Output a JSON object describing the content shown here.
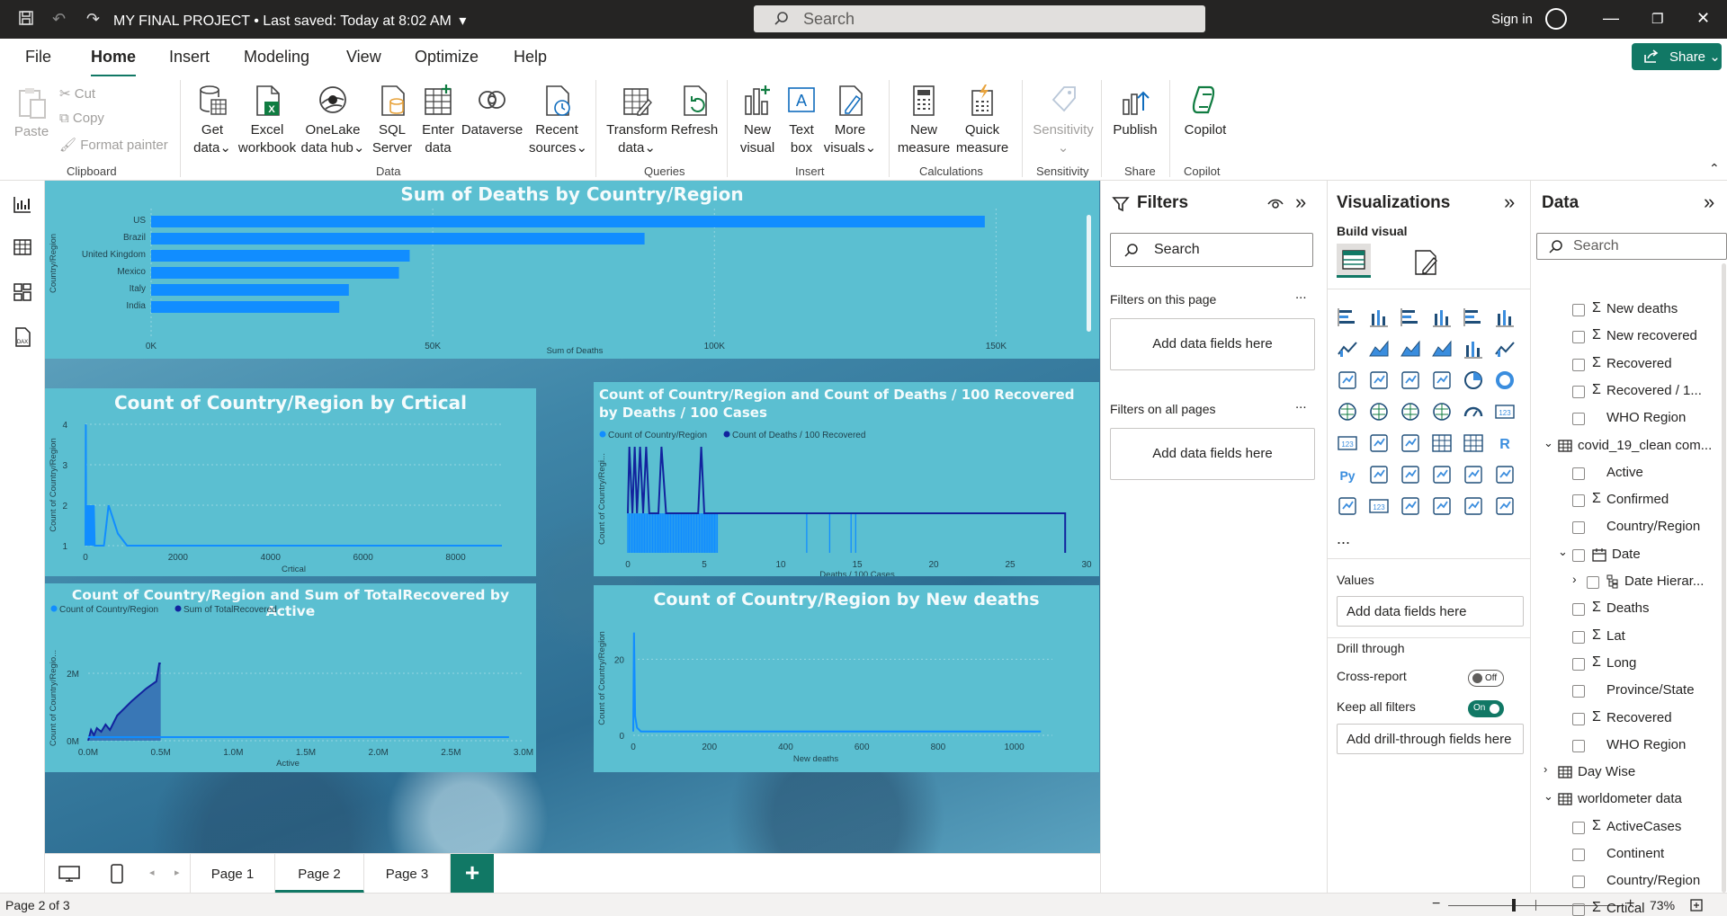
{
  "titlebar": {
    "project": "MY FINAL PROJECT",
    "saved": "• Last saved: Today at 8:02 AM",
    "search_placeholder": "Search",
    "sign_in": "Sign in"
  },
  "menu_tabs": [
    "File",
    "Home",
    "Insert",
    "Modeling",
    "View",
    "Optimize",
    "Help"
  ],
  "share_label": "Share",
  "ribbon": {
    "clipboard": {
      "paste": "Paste",
      "cut": "Cut",
      "copy": "Copy",
      "format_painter": "Format painter",
      "label": "Clipboard"
    },
    "data": {
      "get_data": [
        "Get",
        "data"
      ],
      "excel": [
        "Excel",
        "workbook"
      ],
      "onelake": [
        "OneLake",
        "data hub"
      ],
      "sql": [
        "SQL",
        "Server"
      ],
      "enter": [
        "Enter",
        "data"
      ],
      "dataverse": [
        "Dataverse",
        ""
      ],
      "recent": [
        "Recent",
        "sources"
      ],
      "label": "Data"
    },
    "queries": {
      "transform": [
        "Transform",
        "data"
      ],
      "refresh": [
        "Refresh",
        ""
      ],
      "label": "Queries"
    },
    "insert": {
      "new_visual": [
        "New",
        "visual"
      ],
      "text_box": [
        "Text",
        "box"
      ],
      "more_visuals": [
        "More",
        "visuals"
      ],
      "label": "Insert"
    },
    "calculations": {
      "new_measure": [
        "New",
        "measure"
      ],
      "quick_measure": [
        "Quick",
        "measure"
      ],
      "label": "Calculations"
    },
    "sensitivity": {
      "btn": [
        "Sensitivity",
        ""
      ],
      "label": "Sensitivity"
    },
    "share": {
      "publish": [
        "Publish",
        ""
      ],
      "label": "Share"
    },
    "copilot": {
      "btn": [
        "Copilot",
        ""
      ],
      "label": "Copilot"
    }
  },
  "chart_data": [
    {
      "id": "deaths_by_country",
      "type": "bar",
      "title": "Sum of Deaths by Country/Region",
      "xlabel": "Sum of Deaths",
      "ylabel": "Country/Region",
      "categories": [
        "US",
        "Brazil",
        "United Kingdom",
        "Mexico",
        "Italy",
        "India"
      ],
      "values": [
        148000,
        87600,
        45900,
        44000,
        35100,
        33400
      ],
      "xlim": [
        0,
        160000
      ],
      "xticks": [
        "0K",
        "50K",
        "100K",
        "150K"
      ],
      "grid": true
    },
    {
      "id": "count_by_critical",
      "type": "line",
      "title": "Count of Country/Region by Crtical",
      "xlabel": "Crtical",
      "ylabel": "Count of Country/Region",
      "x": [
        0,
        8,
        15,
        30,
        45,
        60,
        75,
        90,
        105,
        120,
        135,
        150,
        165,
        180,
        200,
        230,
        270,
        320,
        400,
        500,
        700,
        900,
        1100,
        9000
      ],
      "y": [
        1,
        4,
        1,
        2,
        1,
        2,
        1,
        2,
        1,
        2,
        1,
        2,
        1,
        2,
        1,
        1,
        1,
        1,
        1,
        2,
        1.3,
        1,
        1,
        1
      ],
      "xlim": [
        0,
        9000
      ],
      "ylim": [
        1,
        4
      ],
      "xticks": [
        "0",
        "2000",
        "4000",
        "6000",
        "8000"
      ],
      "yticks": [
        "1",
        "2",
        "3",
        "4"
      ]
    },
    {
      "id": "count_and_deaths100rec_by_deaths100cases",
      "type": "line",
      "title": "Count of Country/Region and Count of Deaths / 100 Recovered by Deaths / 100 Cases",
      "xlabel": "Deaths / 100 Cases",
      "ylabel": "Count of Country/Regi...",
      "legend": [
        "Count of Country/Region",
        "Count of Deaths / 100 Recovered"
      ],
      "legend_position": "top-left",
      "xticks": [
        "0",
        "5",
        "10",
        "15",
        "20",
        "25",
        "30"
      ],
      "xlim": [
        0,
        30
      ]
    },
    {
      "id": "count_and_recovered_by_active",
      "type": "area",
      "title": "Count of Country/Region and Sum of TotalRecovered by Active",
      "xlabel": "Active",
      "ylabel": "Count of Country/Regio...",
      "legend": [
        "Count of Country/Region",
        "Sum of TotalRecovered"
      ],
      "legend_position": "top-left",
      "xticks": [
        "0.0M",
        "0.5M",
        "1.0M",
        "1.5M",
        "2.0M",
        "2.5M",
        "3.0M"
      ],
      "yticks": [
        "0M",
        "2M"
      ],
      "xlim": [
        0,
        3000000
      ]
    },
    {
      "id": "count_by_new_deaths",
      "type": "line",
      "title": "Count of Country/Region by New deaths",
      "xlabel": "New deaths",
      "ylabel": "Count of Country/Region",
      "x": [
        0,
        2,
        5,
        10,
        20,
        40,
        80,
        150,
        300,
        600,
        1070
      ],
      "y": [
        1,
        27,
        5,
        2,
        1,
        1,
        1,
        1,
        1,
        1,
        1
      ],
      "xlim": [
        0,
        1100
      ],
      "ylim": [
        0,
        30
      ],
      "xticks": [
        "0",
        "200",
        "400",
        "600",
        "800",
        "1000"
      ],
      "yticks": [
        "0",
        "20"
      ]
    }
  ],
  "pages": {
    "tabs": [
      "Page 1",
      "Page 2",
      "Page 3"
    ],
    "active": "Page 2",
    "add": "+"
  },
  "status": {
    "page_info": "Page 2 of 3",
    "zoom": "73%",
    "zoom_level": 0.73
  },
  "filters": {
    "title": "Filters",
    "search": "Search",
    "on_this_page": "Filters on this page",
    "on_all_pages": "Filters on all pages",
    "add_fields": "Add data fields here",
    "more": "..."
  },
  "visualizations": {
    "title": "Visualizations",
    "build_visual": "Build visual",
    "more": "...",
    "values": "Values",
    "add_fields": "Add data fields here",
    "drill_through": "Drill through",
    "cross_report": "Cross-report",
    "cross_report_state": "Off",
    "keep_all_filters": "Keep all filters",
    "keep_state": "On",
    "add_drill": "Add drill-through fields here"
  },
  "data_pane": {
    "title": "Data",
    "search": "Search",
    "fields": [
      {
        "name": "New deaths",
        "sigma": true,
        "indent": 2
      },
      {
        "name": "New recovered",
        "sigma": true,
        "indent": 2
      },
      {
        "name": "Recovered",
        "sigma": true,
        "indent": 2
      },
      {
        "name": "Recovered / 1...",
        "sigma": true,
        "indent": 2
      },
      {
        "name": "WHO Region",
        "sigma": false,
        "indent": 2
      },
      {
        "name": "covid_19_clean com...",
        "table": true,
        "indent": 0
      },
      {
        "name": "Active",
        "sigma": false,
        "indent": 2
      },
      {
        "name": "Confirmed",
        "sigma": true,
        "indent": 2
      },
      {
        "name": "Country/Region",
        "sigma": false,
        "indent": 2
      },
      {
        "name": "Date",
        "date": true,
        "indent": 1
      },
      {
        "name": "Date Hierar...",
        "hier": true,
        "indent": 3
      },
      {
        "name": "Deaths",
        "sigma": true,
        "indent": 2
      },
      {
        "name": "Lat",
        "sigma": true,
        "indent": 2
      },
      {
        "name": "Long",
        "sigma": true,
        "indent": 2
      },
      {
        "name": "Province/State",
        "sigma": false,
        "indent": 2
      },
      {
        "name": "Recovered",
        "sigma": true,
        "indent": 2
      },
      {
        "name": "WHO Region",
        "sigma": false,
        "indent": 2
      },
      {
        "name": "Day Wise",
        "table": true,
        "collapsed": true,
        "indent": 0
      },
      {
        "name": "worldometer data",
        "table": true,
        "indent": 0
      },
      {
        "name": "ActiveCases",
        "sigma": true,
        "indent": 2
      },
      {
        "name": "Continent",
        "sigma": false,
        "indent": 2
      },
      {
        "name": "Country/Region",
        "sigma": false,
        "indent": 2
      },
      {
        "name": "Crtical",
        "sigma": true,
        "indent": 2
      }
    ]
  },
  "colors": {
    "accent": "#117865",
    "visual_bg": "#5bbfd1",
    "series1": "#118dff",
    "series2": "#12239e"
  }
}
